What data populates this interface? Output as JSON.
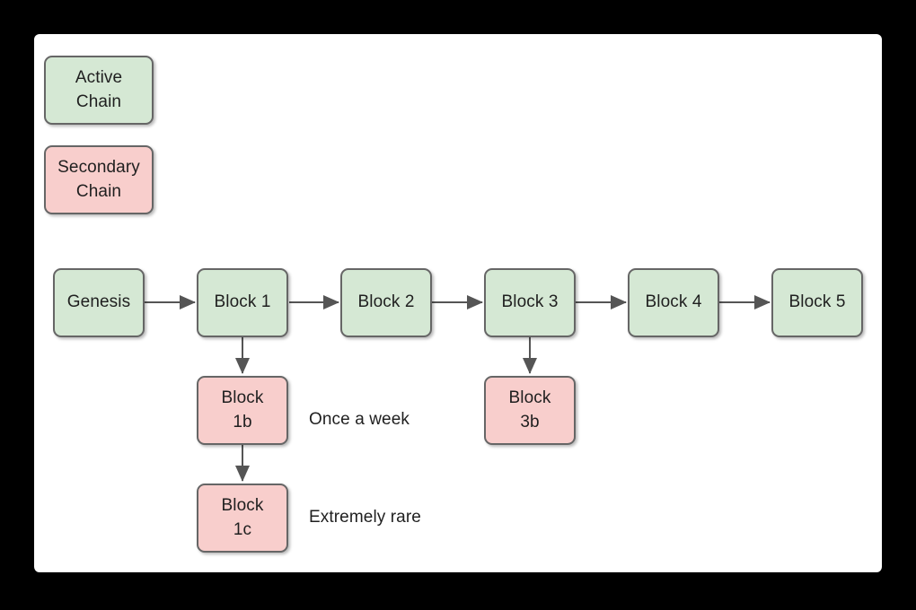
{
  "canvas": {
    "background_color": "#ffffff",
    "page_background_color": "#000000"
  },
  "style": {
    "active_fill": "#d5e8d4",
    "secondary_fill": "#f8cecc",
    "stroke": "#666666",
    "text_color": "#1f1f1f"
  },
  "legend": {
    "items": [
      {
        "id": "active-chain",
        "label": "Active\nChain",
        "kind": "green"
      },
      {
        "id": "secondary-chain",
        "label": "Secondary\nChain",
        "kind": "red"
      }
    ]
  },
  "main_chain": {
    "blocks": [
      {
        "id": "genesis",
        "label": "Genesis",
        "kind": "green"
      },
      {
        "id": "block-1",
        "label": "Block 1",
        "kind": "green"
      },
      {
        "id": "block-2",
        "label": "Block 2",
        "kind": "green"
      },
      {
        "id": "block-3",
        "label": "Block 3",
        "kind": "green"
      },
      {
        "id": "block-4",
        "label": "Block 4",
        "kind": "green"
      },
      {
        "id": "block-5",
        "label": "Block 5",
        "kind": "green"
      }
    ]
  },
  "forks": {
    "blocks": [
      {
        "id": "block-1b",
        "label": "Block\n1b",
        "kind": "red",
        "parent": "block-1"
      },
      {
        "id": "block-1c",
        "label": "Block\n1c",
        "kind": "red",
        "parent": "block-1b"
      },
      {
        "id": "block-3b",
        "label": "Block\n3b",
        "kind": "red",
        "parent": "block-3"
      }
    ]
  },
  "annotations": [
    {
      "id": "once-a-week",
      "text": "Once a week"
    },
    {
      "id": "extremely-rare",
      "text": "Extremely rare"
    }
  ]
}
